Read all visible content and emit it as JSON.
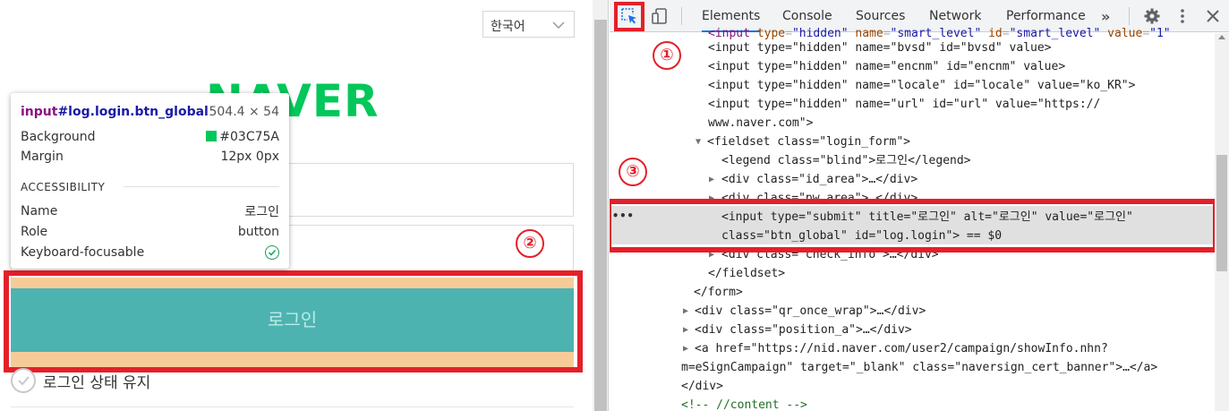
{
  "page": {
    "language_select": "한국어",
    "logo_text": "NAVER",
    "login_button": "로그인",
    "keep_login": "로그인 상태 유지",
    "badge_2": "②"
  },
  "inspect_tooltip": {
    "selector_tag": "input",
    "selector_rest": "#log.login.btn_global",
    "size": "504.4 × 54",
    "background_label": "Background",
    "background_value": "#03C75A",
    "margin_label": "Margin",
    "margin_value": "12px 0px",
    "accessibility_heading": "ACCESSIBILITY",
    "name_label": "Name",
    "name_value": "로그인",
    "role_label": "Role",
    "role_value": "button",
    "focusable_label": "Keyboard-focusable"
  },
  "devtools": {
    "tabs": [
      "Elements",
      "Console",
      "Sources",
      "Network",
      "Performance"
    ],
    "active_tab": "Elements",
    "more_tabs": "»",
    "badge_1": "①",
    "badge_3": "③",
    "ellipsis": "•••"
  },
  "dom": {
    "lines": [
      "<input type=\"hidden\" name=\"bvsd\" id=\"bvsd\" value>",
      "<input type=\"hidden\" name=\"encnm\" id=\"encnm\" value>",
      "<input type=\"hidden\" name=\"locale\" id=\"locale\" value=\"ko_KR\">",
      "<input type=\"hidden\" name=\"url\" id=\"url\" value=\"https://",
      "www.naver.com\">",
      "<fieldset class=\"login_form\">",
      "<legend class=\"blind\">로그인</legend>",
      "<div class=\"id_area\">…</div>",
      "<div class=\"pw_area\">…</div>",
      "<input type=\"submit\" title=\"로그인\" alt=\"로그인\" value=\"로그인\"",
      "class=\"btn_global\" id=\"log.login\"> == $0",
      "<div class=\"check_info\">…</div>",
      "</fieldset>",
      "</form>",
      "<div class=\"qr_once_wrap\">…</div>",
      "<div class=\"position_a\">…</div>",
      "<a href=\"https://nid.naver.com/user2/campaign/showInfo.nhn?",
      "m=eSignCampaign\" target=\"_blank\" class=\"naversign_cert_banner\">…</a>",
      "</div>",
      "<!-- //content -->"
    ]
  },
  "colors": {
    "naver_green": "#03c75a",
    "annotation_red": "#e3202a",
    "button_overlay": "#4db3b1",
    "margin_overlay": "#f7cb98"
  }
}
